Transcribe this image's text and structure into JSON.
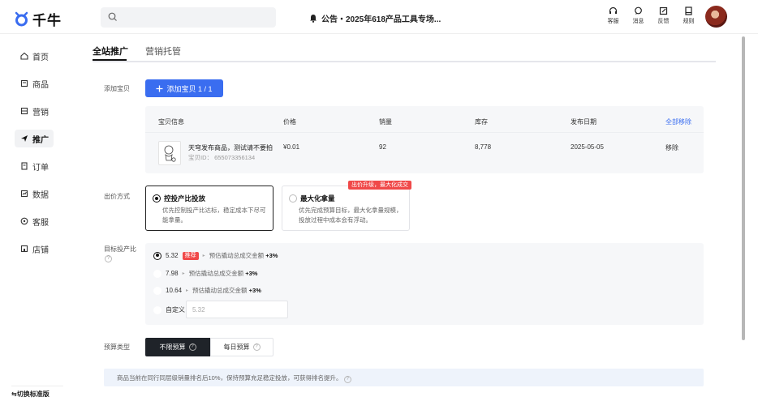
{
  "app": {
    "logo_text": "千牛"
  },
  "header": {
    "search_placeholder": "",
    "notice": "公告・2025年618产品工具专场...",
    "tools": [
      {
        "icon": "headset-icon",
        "label": "客服"
      },
      {
        "icon": "message-icon",
        "label": "消息"
      },
      {
        "icon": "feedback-icon",
        "label": "反馈"
      },
      {
        "icon": "rules-icon",
        "label": "规则"
      }
    ]
  },
  "sidebar": {
    "items": [
      {
        "icon": "home-icon",
        "label": "首页"
      },
      {
        "icon": "goods-icon",
        "label": "商品"
      },
      {
        "icon": "marketing-icon",
        "label": "营销"
      },
      {
        "icon": "promotion-icon",
        "label": "推广",
        "active": true
      },
      {
        "icon": "order-icon",
        "label": "订单"
      },
      {
        "icon": "data-icon",
        "label": "数据"
      },
      {
        "icon": "service-icon",
        "label": "客服"
      },
      {
        "icon": "shop-icon",
        "label": "店铺"
      }
    ],
    "switch_label": "切换标准版"
  },
  "tabs": [
    {
      "label": "全站推广",
      "active": true
    },
    {
      "label": "营销托管",
      "active": false
    }
  ],
  "add_item": {
    "label": "添加宝贝",
    "button": "添加宝贝 1 / 1"
  },
  "product_table": {
    "headers": [
      "宝贝信息",
      "价格",
      "销量",
      "库存",
      "发布日期"
    ],
    "remove_all": "全部移除",
    "rows": [
      {
        "name": "天穹发布商品，测试请不要拍",
        "id": "宝贝ID： 655073356134",
        "price": "¥0.01",
        "sales": "92",
        "stock": "8,778",
        "date": "2025-05-05",
        "action": "移除"
      }
    ]
  },
  "bidding": {
    "label": "出价方式",
    "badge": "出价升级，最大化成交",
    "options": [
      {
        "title": "控投产比投放",
        "desc": "优先控制投产比达标，稳定成本下尽可能拿量。",
        "selected": true
      },
      {
        "title": "最大化拿量",
        "desc": "优先完成预算目标，最大化拿量规模，投放过程中成本会有浮动。",
        "selected": false
      }
    ]
  },
  "target_roi": {
    "label": "目标投产比",
    "options": [
      {
        "value": "5.32",
        "tag": "推荐",
        "est": "预估撬动总成交金额",
        "delta": "+3%",
        "selected": true
      },
      {
        "value": "7.98",
        "tag": "",
        "est": "预估撬动总成交金额",
        "delta": "+3%",
        "selected": false
      },
      {
        "value": "10.64",
        "tag": "",
        "est": "预估撬动总成交金额",
        "delta": "+3%",
        "selected": false
      }
    ],
    "custom": {
      "label": "自定义",
      "placeholder": "5.32"
    }
  },
  "budget": {
    "label": "预算类型",
    "options": [
      {
        "label": "不限预算",
        "selected": true
      },
      {
        "label": "每日预算",
        "selected": false
      }
    ]
  },
  "tip": "商品当前在同行同层级销量排名后10%，保持预算充足稳定投放，可获得排名提升。",
  "colors": {
    "accent": "#3a6df0",
    "danger": "#f04949",
    "dark": "#1f2329"
  }
}
